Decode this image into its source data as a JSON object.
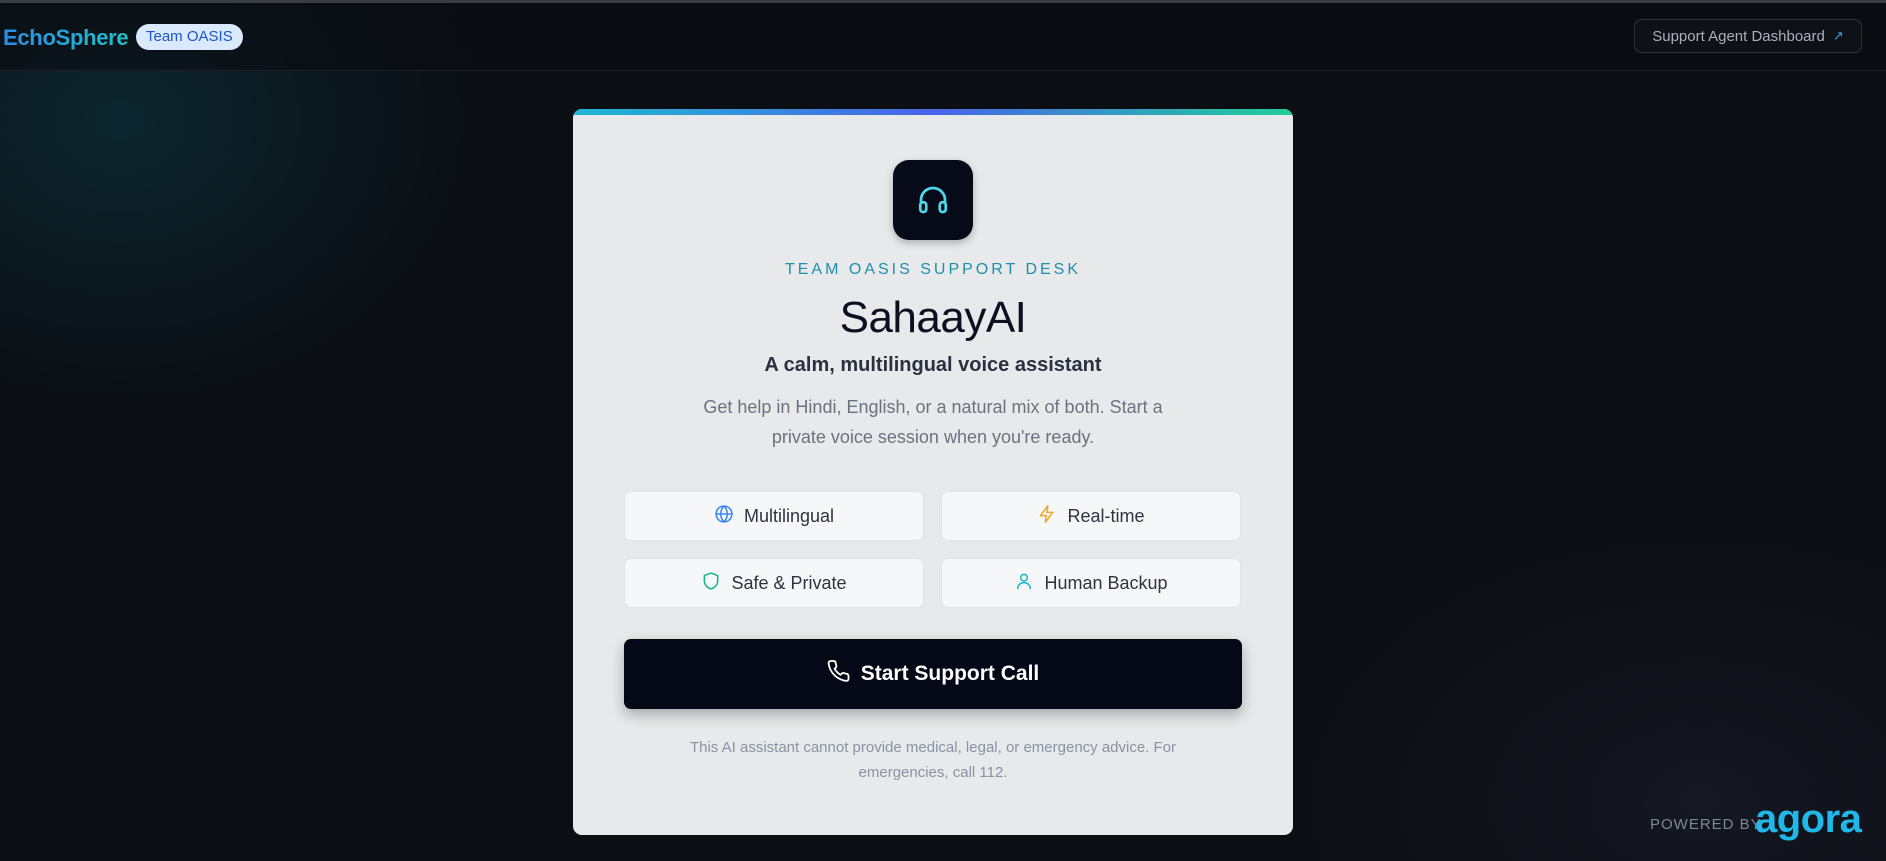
{
  "header": {
    "brand": "EchoSphere",
    "team_badge": "Team OASIS",
    "dashboard_button": "Support Agent Dashboard",
    "dashboard_arrow": "↗"
  },
  "card": {
    "logo_icon": "headphones-icon",
    "eyebrow": "TEAM OASIS SUPPORT DESK",
    "title": "SahaayAI",
    "subtitle": "A calm, multilingual voice assistant",
    "description": "Get help in Hindi, English, or a natural mix of both. Start a private voice session when you're ready.",
    "features": [
      {
        "label": "Multilingual",
        "icon": "globe-icon",
        "color": "#3b82f6"
      },
      {
        "label": "Real-time",
        "icon": "lightning-icon",
        "color": "#f5a524"
      },
      {
        "label": "Safe & Private",
        "icon": "shield-icon",
        "color": "#10b981"
      },
      {
        "label": "Human Backup",
        "icon": "user-icon",
        "color": "#14b8c8"
      }
    ],
    "call_button": "Start Support Call",
    "call_icon": "phone-icon",
    "disclaimer": "This AI assistant cannot provide medical, legal, or emergency advice. For emergencies, call 112."
  },
  "footer": {
    "powered_by": "POWERED BY",
    "partner": "agora"
  },
  "colors": {
    "accent": "#1f8fae",
    "brand_gradient_start": "#2a8de8",
    "brand_gradient_end": "#22c0c8",
    "button_bg": "#050816",
    "card_bg": "#e8e9ea",
    "page_bg": "#0b0e13"
  }
}
